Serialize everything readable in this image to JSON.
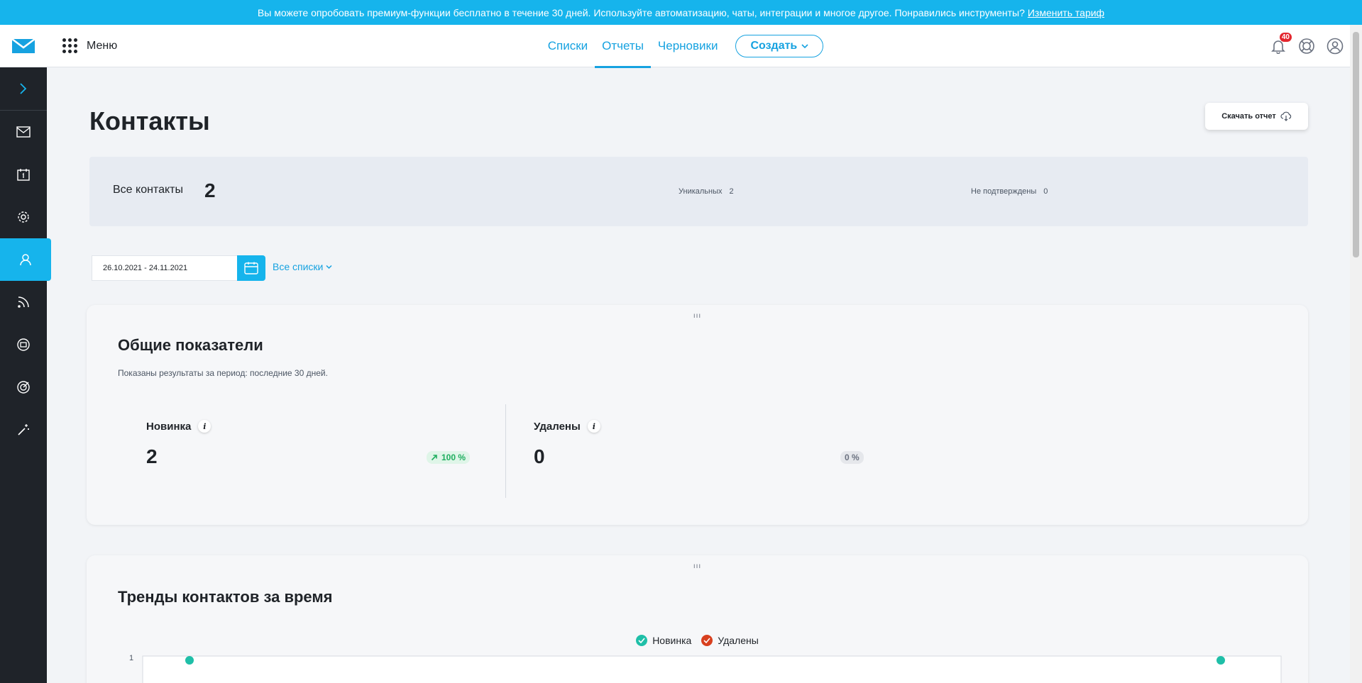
{
  "banner": {
    "text": "Вы можете опробовать премиум-функции бесплатно в течение 30 дней. Используйте автоматизацию, чаты, интеграции и многое другое. Понравились инструменты?",
    "link": "Изменить тариф"
  },
  "header": {
    "menu_label": "Меню",
    "tabs": [
      {
        "label": "Списки"
      },
      {
        "label": "Отчеты",
        "active": true
      },
      {
        "label": "Черновики"
      }
    ],
    "create_label": "Создать",
    "notifications_count": "40"
  },
  "sidebar": {
    "items": [
      "expand-icon",
      "mail-icon",
      "calendar-icon",
      "settings-icon",
      "contacts-icon",
      "rss-icon",
      "webinar-icon",
      "target-icon",
      "magic-wand-icon"
    ],
    "active_index": 4
  },
  "page": {
    "title": "Контакты",
    "download_label": "Скачать отчет"
  },
  "summary": {
    "all_label": "Все контакты",
    "all_value": "2",
    "unique_label": "Уникальных",
    "unique_value": "2",
    "unconfirmed_label": "Не подтверждены",
    "unconfirmed_value": "0"
  },
  "filters": {
    "date_range": "26.10.2021 - 24.11.2021",
    "lists_label": "Все списки"
  },
  "overview": {
    "title": "Общие показатели",
    "subtitle": "Показаны результаты за период: последние 30 дней.",
    "metrics": [
      {
        "label": "Новинка",
        "value": "2",
        "change": "100 %"
      },
      {
        "label": "Удалены",
        "value": "0",
        "change": "0 %"
      }
    ]
  },
  "trends": {
    "title": "Тренды контактов за время",
    "legend": [
      {
        "label": "Новинка",
        "color": "#1fbfa8"
      },
      {
        "label": "Удалены",
        "color": "#d8401f"
      }
    ]
  },
  "chart_data": {
    "type": "line",
    "series": [
      {
        "name": "Новинка",
        "values": [
          1,
          1
        ]
      },
      {
        "name": "Удалены",
        "values": []
      }
    ],
    "y_tick_top": "1",
    "ylim": [
      0,
      1
    ]
  },
  "colors": {
    "accent": "#16b4ec",
    "sidebar": "#1f2329",
    "positive": "#1fae5f"
  }
}
